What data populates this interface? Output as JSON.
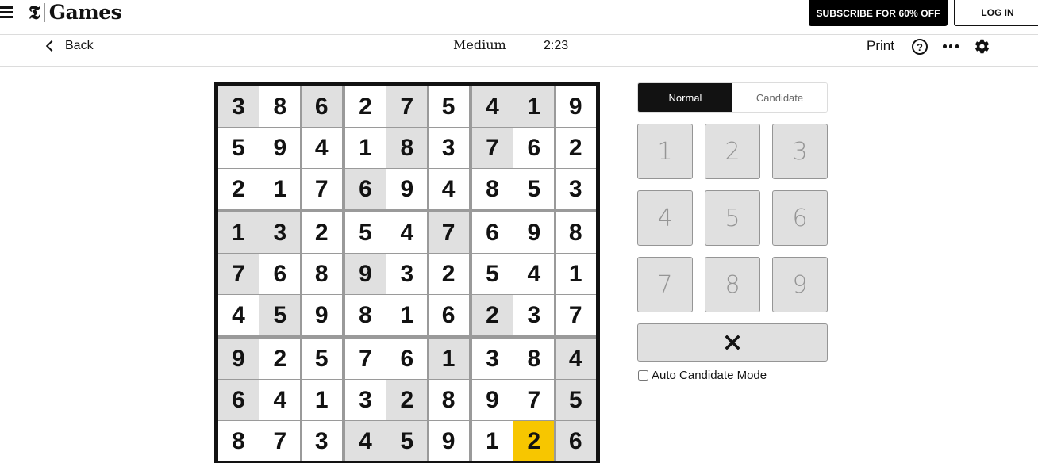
{
  "header": {
    "menu_icon": "hamburger-icon",
    "logo_mark": "𝕿",
    "logo_text": "Games",
    "subscribe_label": "SUBSCRIBE FOR 60% OFF",
    "login_label": "LOG IN"
  },
  "toolbar": {
    "back_label": "Back",
    "difficulty": "Medium",
    "timer": "2:23",
    "print_label": "Print",
    "help_icon": "?",
    "more_icon": "more-icon",
    "settings_icon": "gear-icon"
  },
  "board": {
    "rows": [
      [
        "3",
        "8",
        "6",
        "2",
        "7",
        "5",
        "4",
        "1",
        "9"
      ],
      [
        "5",
        "9",
        "4",
        "1",
        "8",
        "3",
        "7",
        "6",
        "2"
      ],
      [
        "2",
        "1",
        "7",
        "6",
        "9",
        "4",
        "8",
        "5",
        "3"
      ],
      [
        "1",
        "3",
        "2",
        "5",
        "4",
        "7",
        "6",
        "9",
        "8"
      ],
      [
        "7",
        "6",
        "8",
        "9",
        "3",
        "2",
        "5",
        "4",
        "1"
      ],
      [
        "4",
        "5",
        "9",
        "8",
        "1",
        "6",
        "2",
        "3",
        "7"
      ],
      [
        "9",
        "2",
        "5",
        "7",
        "6",
        "1",
        "3",
        "8",
        "4"
      ],
      [
        "6",
        "4",
        "1",
        "3",
        "2",
        "8",
        "9",
        "7",
        "5"
      ],
      [
        "8",
        "7",
        "3",
        "4",
        "5",
        "9",
        "1",
        "2",
        "6"
      ]
    ],
    "shaded": [
      [
        1,
        0,
        1,
        0,
        1,
        0,
        1,
        1,
        0
      ],
      [
        0,
        0,
        0,
        0,
        1,
        0,
        1,
        0,
        0
      ],
      [
        0,
        0,
        0,
        1,
        0,
        0,
        0,
        0,
        0
      ],
      [
        1,
        1,
        0,
        0,
        0,
        1,
        0,
        0,
        0
      ],
      [
        1,
        0,
        0,
        1,
        0,
        0,
        0,
        0,
        0
      ],
      [
        0,
        1,
        0,
        0,
        0,
        0,
        1,
        0,
        0
      ],
      [
        1,
        0,
        0,
        0,
        0,
        1,
        0,
        0,
        1
      ],
      [
        1,
        0,
        0,
        0,
        1,
        0,
        0,
        0,
        1
      ],
      [
        0,
        0,
        0,
        1,
        1,
        0,
        0,
        0,
        1
      ]
    ],
    "selected": [
      8,
      7
    ],
    "colors": {
      "selected": "#f7c600",
      "shaded": "#e0e0e0"
    }
  },
  "controls": {
    "modes": [
      {
        "label": "Normal",
        "active": true
      },
      {
        "label": "Candidate",
        "active": false
      }
    ],
    "numpad": [
      "1",
      "2",
      "3",
      "4",
      "5",
      "6",
      "7",
      "8",
      "9"
    ],
    "erase_icon": "close-icon",
    "auto_candidate_label": "Auto Candidate Mode",
    "auto_candidate_checked": false
  }
}
